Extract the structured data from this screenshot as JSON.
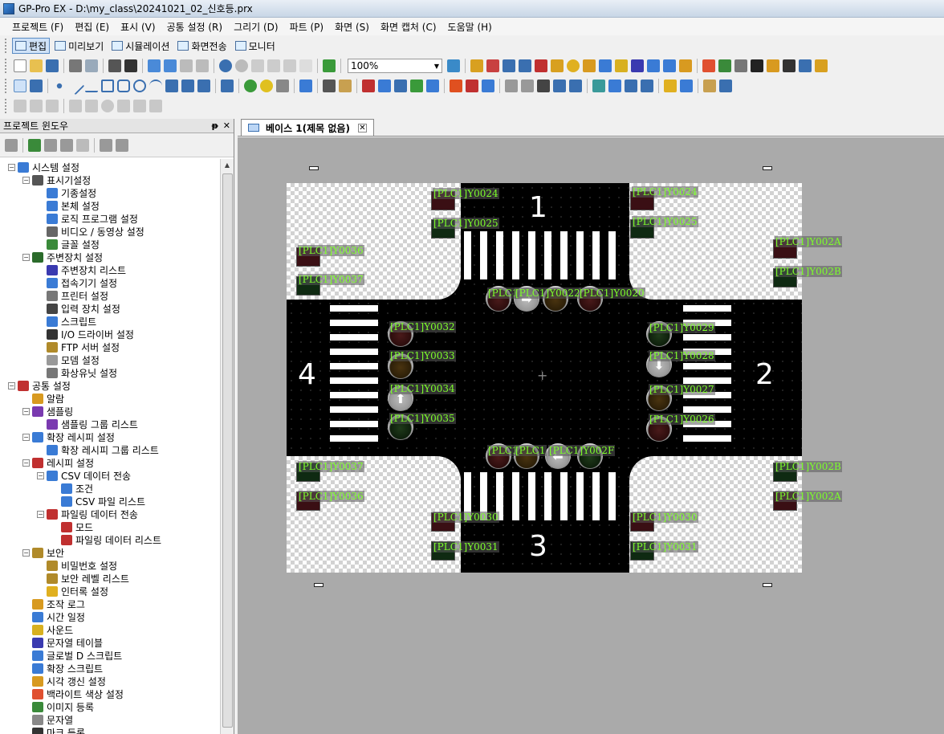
{
  "window": {
    "title": "GP-Pro EX - D:\\my_class\\20241021_02_신호등.prx"
  },
  "menu": [
    "프로젝트 (F)",
    "편집 (E)",
    "표시 (V)",
    "공통 설정 (R)",
    "그리기 (D)",
    "파트 (P)",
    "화면 (S)",
    "화면 캡처 (C)",
    "도움말 (H)"
  ],
  "modes": [
    "편집",
    "미리보기",
    "시뮬레이션",
    "화면전송",
    "모니터"
  ],
  "zoom": "100%",
  "panel": {
    "title": "프로젝트 윈도우",
    "pin": "ᵽ",
    "close": "✕"
  },
  "tree": [
    {
      "label": "시스템 설정",
      "level": 0,
      "toggle": "−",
      "color": "#3a7bd5"
    },
    {
      "label": "표시기설정",
      "level": 1,
      "toggle": "−",
      "color": "#555"
    },
    {
      "label": "기종설정",
      "level": 2,
      "toggle": "",
      "color": "#3a7bd5"
    },
    {
      "label": "본체 설정",
      "level": 2,
      "toggle": "",
      "color": "#3a7bd5"
    },
    {
      "label": "로직 프로그램 설정",
      "level": 2,
      "toggle": "",
      "color": "#3a7bd5"
    },
    {
      "label": "비디오 / 동영상 설정",
      "level": 2,
      "toggle": "",
      "color": "#666"
    },
    {
      "label": "글꼴 설정",
      "level": 2,
      "toggle": "",
      "color": "#3a8a3a"
    },
    {
      "label": "주변장치 설정",
      "level": 1,
      "toggle": "−",
      "color": "#2b6b2b"
    },
    {
      "label": "주변장치 리스트",
      "level": 2,
      "toggle": "",
      "color": "#3a3ab0"
    },
    {
      "label": "접속기기 설정",
      "level": 2,
      "toggle": "",
      "color": "#3a7bd5"
    },
    {
      "label": "프린터 설정",
      "level": 2,
      "toggle": "",
      "color": "#777"
    },
    {
      "label": "입력 장치 설정",
      "level": 2,
      "toggle": "",
      "color": "#444"
    },
    {
      "label": "스크립트",
      "level": 2,
      "toggle": "",
      "color": "#3a7bd5"
    },
    {
      "label": "I/O 드라이버 설정",
      "level": 2,
      "toggle": "",
      "color": "#333"
    },
    {
      "label": "FTP 서버 설정",
      "level": 2,
      "toggle": "",
      "color": "#b08a2a"
    },
    {
      "label": "모뎀 설정",
      "level": 2,
      "toggle": "",
      "color": "#999"
    },
    {
      "label": "화상유닛 설정",
      "level": 2,
      "toggle": "",
      "color": "#777"
    },
    {
      "label": "공통 설정",
      "level": 0,
      "toggle": "−",
      "color": "#c03030"
    },
    {
      "label": "알람",
      "level": 1,
      "toggle": "",
      "color": "#d89a20"
    },
    {
      "label": "샘플링",
      "level": 1,
      "toggle": "−",
      "color": "#7a3ab0"
    },
    {
      "label": "샘플링 그룹 리스트",
      "level": 2,
      "toggle": "",
      "color": "#7a3ab0"
    },
    {
      "label": "확장 레시피 설정",
      "level": 1,
      "toggle": "−",
      "color": "#3a7bd5"
    },
    {
      "label": "확장 레시피 그룹 리스트",
      "level": 2,
      "toggle": "",
      "color": "#3a7bd5"
    },
    {
      "label": "레시피 설정",
      "level": 1,
      "toggle": "−",
      "color": "#c03030"
    },
    {
      "label": "CSV 데이터 전송",
      "level": 2,
      "toggle": "−",
      "color": "#3a7bd5"
    },
    {
      "label": "조건",
      "level": 3,
      "toggle": "",
      "color": "#3a7bd5"
    },
    {
      "label": "CSV 파일 리스트",
      "level": 3,
      "toggle": "",
      "color": "#3a7bd5"
    },
    {
      "label": "파일링 데이터 전송",
      "level": 2,
      "toggle": "−",
      "color": "#c03030"
    },
    {
      "label": "모드",
      "level": 3,
      "toggle": "",
      "color": "#c03030"
    },
    {
      "label": "파일링 데이터 리스트",
      "level": 3,
      "toggle": "",
      "color": "#c03030"
    },
    {
      "label": "보안",
      "level": 1,
      "toggle": "−",
      "color": "#b08a2a"
    },
    {
      "label": "비밀번호 설정",
      "level": 2,
      "toggle": "",
      "color": "#b08a2a"
    },
    {
      "label": "보안 레벨 리스트",
      "level": 2,
      "toggle": "",
      "color": "#b08a2a"
    },
    {
      "label": "인터록 설정",
      "level": 2,
      "toggle": "",
      "color": "#e0b020"
    },
    {
      "label": "조작 로그",
      "level": 1,
      "toggle": "",
      "color": "#d89a20"
    },
    {
      "label": "시간 일정",
      "level": 1,
      "toggle": "",
      "color": "#3a7bd5"
    },
    {
      "label": "사운드",
      "level": 1,
      "toggle": "",
      "color": "#d8b020"
    },
    {
      "label": "문자열 테이블",
      "level": 1,
      "toggle": "",
      "color": "#3a3ab0"
    },
    {
      "label": "글로벌 D 스크립트",
      "level": 1,
      "toggle": "",
      "color": "#3a7bd5"
    },
    {
      "label": "확장 스크립트",
      "level": 1,
      "toggle": "",
      "color": "#3a7bd5"
    },
    {
      "label": "시각 갱신 설정",
      "level": 1,
      "toggle": "",
      "color": "#d89a20"
    },
    {
      "label": "백라이트 색상 설정",
      "level": 1,
      "toggle": "",
      "color": "#e05030"
    },
    {
      "label": "이미지 등록",
      "level": 1,
      "toggle": "",
      "color": "#3a8a3a"
    },
    {
      "label": "문자열",
      "level": 1,
      "toggle": "",
      "color": "#888"
    },
    {
      "label": "마크 등록",
      "level": 1,
      "toggle": "",
      "color": "#333"
    }
  ],
  "tab": {
    "label": "베이스 1(제목 없음)",
    "close": "✕"
  },
  "canvas": {
    "numbers": [
      "1",
      "2",
      "3",
      "4"
    ],
    "crosshair": "+",
    "tags": {
      "n1a": "[PLC1]Y0024",
      "n1b": "[PLC1]Y0025",
      "n2a": "[PLC1]Y0024",
      "n2b": "[PLC1]Y0025",
      "w1a": "[PLC1]Y0036",
      "w1b": "[PLC1]Y0037",
      "e1a": "[PLC1]Y002A",
      "e1b": "[PLC1]Y002B",
      "top1": "[PLC1",
      "top2": "[PLC1]Y0022",
      "top3": "[PLC1]Y0020",
      "l1": "[PLC1]Y0032",
      "l2": "[PLC1]Y0033",
      "l3": "[PLC1]Y0034",
      "l4": "[PLC1]Y0035",
      "r1": "[PLC1]Y0029",
      "r2": "[PLC1]Y0028",
      "r3": "[PLC1]Y0027",
      "r4": "[PLC1]Y0026",
      "bot1": "[PLC1",
      "bot2": "[PLC1",
      "bot3": "[PLC1]Y002F",
      "w2a": "[PLC1]Y0037",
      "w2b": "[PLC1]Y0036",
      "e2a": "[PLC1]Y002B",
      "e2b": "[PLC1]Y002A",
      "s1a": "[PLC1]Y0030",
      "s1b": "[PLC1]Y0031",
      "s2a": "[PLC1]Y0030",
      "s2b": "[PLC1]Y0031"
    }
  }
}
